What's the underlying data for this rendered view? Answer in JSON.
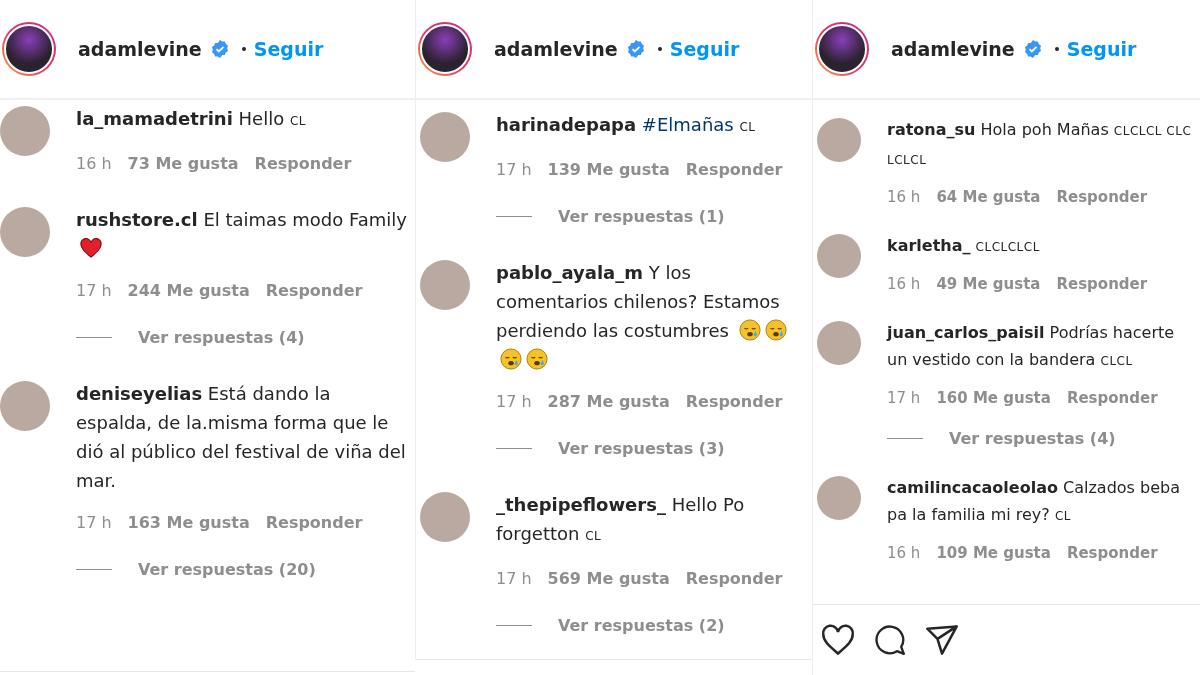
{
  "panels": [
    {
      "header": {
        "username": "adamlevine",
        "verified": true,
        "follow": "Seguir"
      },
      "comments": [
        {
          "username": "la_mamadetrini",
          "text": "Hello",
          "flags": "CL",
          "time": "16 h",
          "likes": "73 Me gusta",
          "reply": "Responder"
        },
        {
          "username": "rushstore.cl",
          "text": "El taimas modo Family",
          "emojis": [
            {
              "kind": "heart"
            }
          ],
          "time": "17 h",
          "likes": "244 Me gusta",
          "reply": "Responder",
          "replies": "Ver respuestas (4)"
        },
        {
          "username": "deniseyelias",
          "text": "Está dando la espalda, de la.misma forma que le dió al público del festival de viña del mar.",
          "time": "17 h",
          "likes": "163 Me gusta",
          "reply": "Responder",
          "replies": "Ver respuestas (20)"
        }
      ]
    },
    {
      "header": {
        "username": "adamlevine",
        "verified": true,
        "follow": "Seguir"
      },
      "comments": [
        {
          "username": "harinadepapa",
          "hashtag": "#Elmañas",
          "flags": "CL",
          "time": "17 h",
          "likes": "139 Me gusta",
          "reply": "Responder",
          "replies": "Ver respuestas (1)"
        },
        {
          "username": "pablo_ayala_m",
          "text": "Y los comentarios chilenos? Estamos perdiendo las costumbres",
          "emojis": [
            {
              "kind": "crying"
            },
            {
              "kind": "crying"
            },
            {
              "kind": "crying"
            },
            {
              "kind": "crying"
            }
          ],
          "time": "17 h",
          "likes": "287 Me gusta",
          "reply": "Responder",
          "replies": "Ver respuestas (3)"
        },
        {
          "username": "_thepipeflowers_",
          "text": "Hello Po forgetton",
          "flags": "CL",
          "time": "17 h",
          "likes": "569 Me gusta",
          "reply": "Responder",
          "replies": "Ver respuestas (2)"
        }
      ]
    },
    {
      "header": {
        "username": "adamlevine",
        "verified": true,
        "follow": "Seguir"
      },
      "comments": [
        {
          "username": "ratona_su",
          "text": "Hola poh Mañas",
          "flags": "CLCLCL CLCLCLCL",
          "time": "16 h",
          "likes": "64 Me gusta",
          "reply": "Responder"
        },
        {
          "username": "karletha_",
          "flags": "CLCLCLCL",
          "time": "16 h",
          "likes": "49 Me gusta",
          "reply": "Responder"
        },
        {
          "username": "juan_carlos_paisil",
          "text": "Podrías hacerte un vestido con la bandera",
          "flags": "CLCL",
          "time": "17 h",
          "likes": "160 Me gusta",
          "reply": "Responder",
          "replies": "Ver respuestas (4)"
        },
        {
          "username": "camilincacaoleolao",
          "text": "Calzados beba pa la familia mi rey?",
          "flags": "CL",
          "time": "16 h",
          "likes": "109 Me gusta",
          "reply": "Responder"
        }
      ],
      "actions": [
        {
          "kind": "like"
        },
        {
          "kind": "comment"
        },
        {
          "kind": "share"
        }
      ]
    }
  ]
}
